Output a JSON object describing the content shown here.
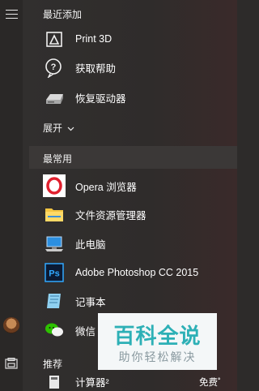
{
  "recent": {
    "header": "最近添加",
    "items": [
      {
        "label": "Print 3D",
        "icon": "print-3d-icon"
      },
      {
        "label": "获取帮助",
        "icon": "get-help-icon"
      },
      {
        "label": "恢复驱动器",
        "icon": "recovery-drive-icon"
      }
    ]
  },
  "expand_label": "展开",
  "most_used": {
    "header": "最常用",
    "items": [
      {
        "label": "Opera 浏览器",
        "icon": "opera-icon"
      },
      {
        "label": "文件资源管理器",
        "icon": "file-explorer-icon"
      },
      {
        "label": "此电脑",
        "icon": "this-pc-icon"
      },
      {
        "label": "Adobe Photoshop CC 2015",
        "icon": "photoshop-icon"
      },
      {
        "label": "记事本",
        "icon": "notepad-icon"
      },
      {
        "label": "微信",
        "icon": "wechat-icon"
      }
    ]
  },
  "recommended": {
    "header": "推荐",
    "item_label": "计算器²",
    "badge": "免费˚"
  },
  "watermark": {
    "title": "百科全说",
    "subtitle": "助你轻松解决"
  },
  "colors": {
    "opera": "#e0202e",
    "photoshop_bg": "#0b1a33",
    "photoshop_fg": "#31a8ff",
    "wechat": "#2dc100",
    "watermark": "#2db0b6"
  }
}
